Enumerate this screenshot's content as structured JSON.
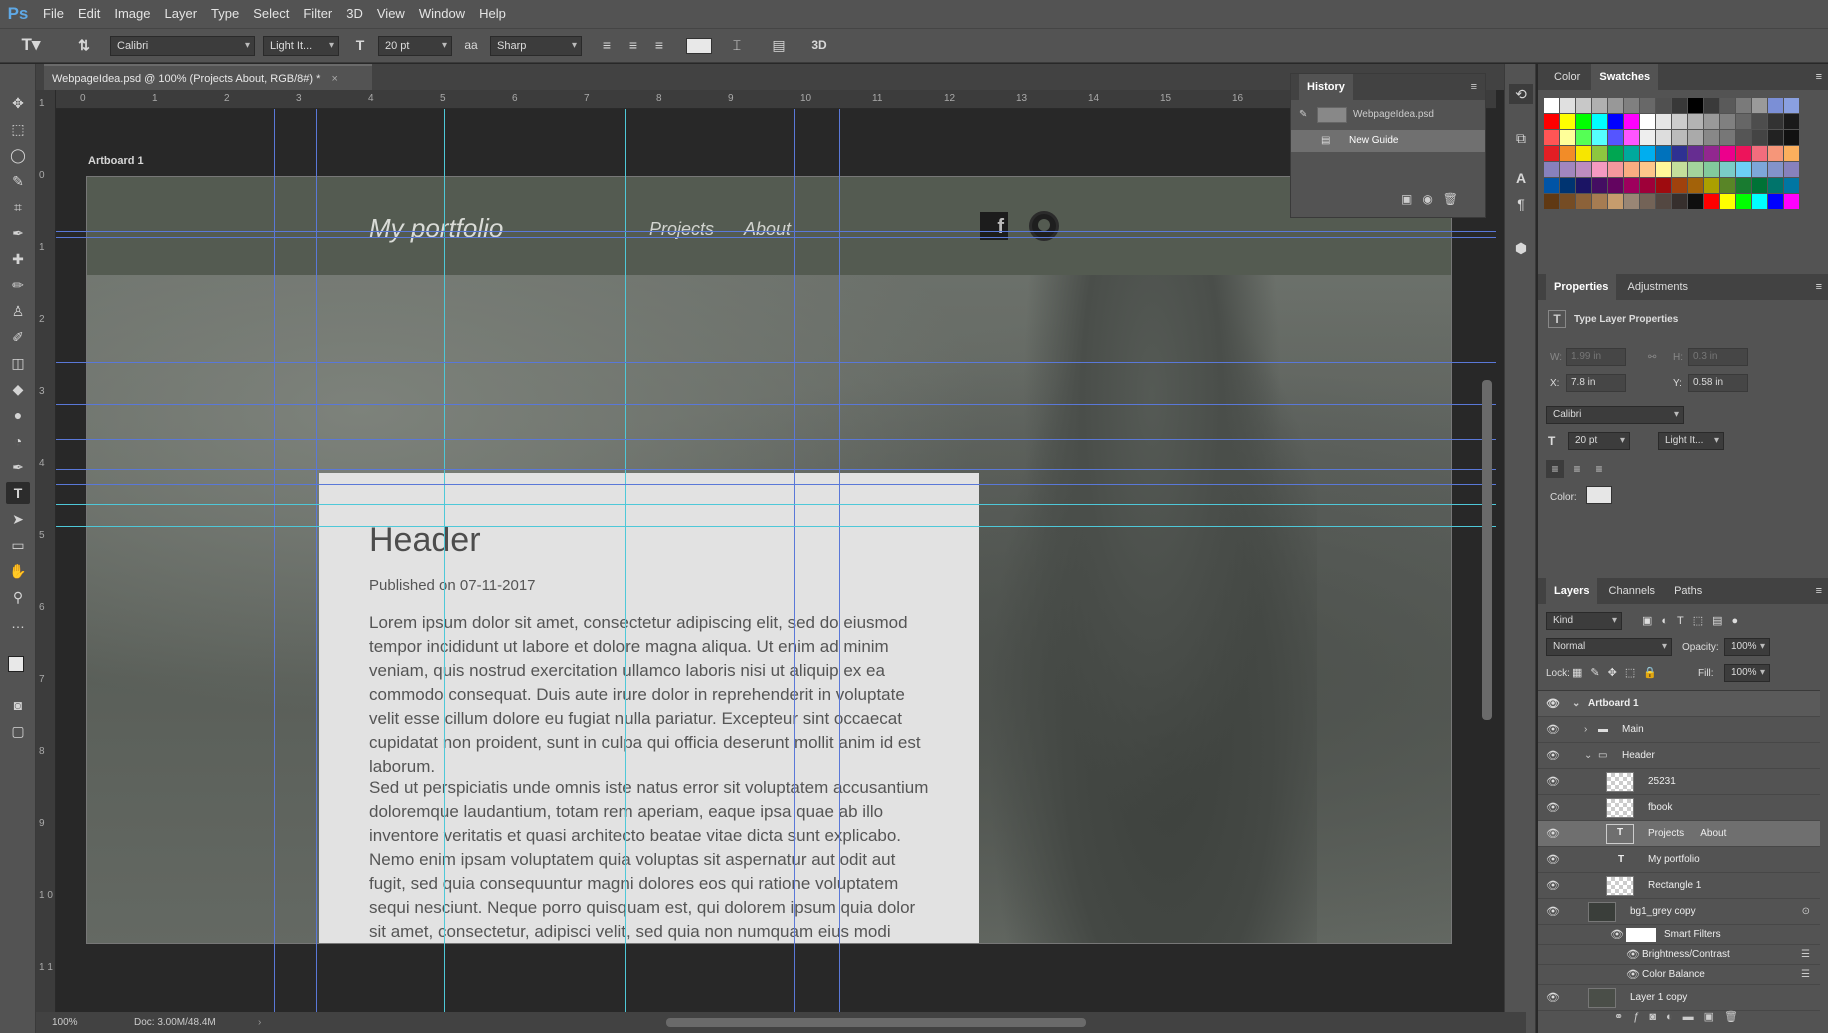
{
  "app": {
    "logo": "Ps",
    "menu": [
      "File",
      "Edit",
      "Image",
      "Layer",
      "Type",
      "Select",
      "Filter",
      "3D",
      "View",
      "Window",
      "Help"
    ]
  },
  "options": {
    "font_family": "Calibri",
    "font_style": "Light It...",
    "font_size": "20 pt",
    "antialias": "Sharp",
    "aa_icon": "aa",
    "t_icon": "T"
  },
  "document": {
    "tab_title": "WebpageIdea.psd @ 100% (Projects      About, RGB/8#) *",
    "close": "×"
  },
  "ruler": {
    "top": [
      "0",
      "1",
      "2",
      "3",
      "4",
      "5",
      "6",
      "7",
      "8",
      "9",
      "10",
      "11",
      "12",
      "13",
      "14",
      "15",
      "16"
    ],
    "left": [
      "1",
      "0",
      "1",
      "2",
      "3",
      "4",
      "5",
      "6",
      "7",
      "8",
      "9",
      "1 0",
      "1 1"
    ]
  },
  "canvas": {
    "artboard_label": "Artboard 1"
  },
  "site": {
    "brand": "My portfolio",
    "nav": [
      "Projects",
      "About"
    ],
    "fb": "f"
  },
  "post": {
    "title": "Header",
    "date": "Published on 07-11-2017",
    "para1": "Lorem ipsum dolor sit amet, consectetur adipiscing elit, sed do eiusmod tempor incididunt ut labore et dolore magna aliqua. Ut enim ad minim veniam, quis nostrud exercitation ullamco laboris nisi ut aliquip ex ea commodo consequat. Duis aute irure dolor in reprehenderit in voluptate velit esse cillum dolore eu fugiat nulla pariatur. Excepteur sint occaecat cupidatat non proident, sunt in culpa qui officia deserunt mollit anim id est laborum.",
    "para2": "Sed ut perspiciatis unde omnis iste natus error sit voluptatem accusantium doloremque laudantium, totam rem aperiam, eaque ipsa quae ab illo inventore veritatis et quasi architecto beatae vitae dicta sunt explicabo. Nemo enim ipsam voluptatem quia voluptas sit aspernatur aut odit aut fugit, sed quia consequuntur magni dolores eos qui ratione voluptatem sequi nesciunt. Neque porro quisquam est, qui dolorem ipsum quia dolor sit amet, consectetur, adipisci velit, sed quia non numquam eius modi tempora incidunt ut labore et dolore magnam aliquam quaerat voluptatem. Ut enim ad minima veniam, quis nostrum exercitationem ullam corporis suscipit"
  },
  "history": {
    "tab": "History",
    "items": [
      "WebpageIdea.psd",
      "New Guide"
    ]
  },
  "swatches": {
    "tabs": [
      "Color",
      "Swatches"
    ]
  },
  "properties": {
    "tabs": [
      "Properties",
      "Adjustments"
    ],
    "title": "Type Layer Properties",
    "w_label": "W:",
    "w_val": "1.99 in",
    "h_label": "H:",
    "h_val": "0.3 in",
    "x_label": "X:",
    "x_val": "7.8 in",
    "y_label": "Y:",
    "y_val": "0.58 in",
    "font": "Calibri",
    "size": "20 pt",
    "style": "Light It...",
    "color_label": "Color:"
  },
  "layers_panel": {
    "tabs": [
      "Layers",
      "Channels",
      "Paths"
    ],
    "kind": "Kind",
    "blend": "Normal",
    "opacity_label": "Opacity:",
    "opacity": "100%",
    "lock_label": "Lock:",
    "fill_label": "Fill:",
    "fill": "100%",
    "rows": [
      "Artboard 1",
      "Main",
      "Header",
      "25231",
      "fbook",
      "Projects      About",
      "My portfolio",
      "Rectangle 1",
      "bg1_grey copy",
      "Smart Filters",
      "Brightness/Contrast",
      "Color Balance",
      "Layer 1 copy"
    ]
  },
  "status": {
    "zoom": "100%",
    "doc": "Doc: 3.00M/48.4M"
  },
  "colors": {
    "bg": "#282828",
    "panel": "#535353",
    "accent": "#5fa9e6"
  }
}
